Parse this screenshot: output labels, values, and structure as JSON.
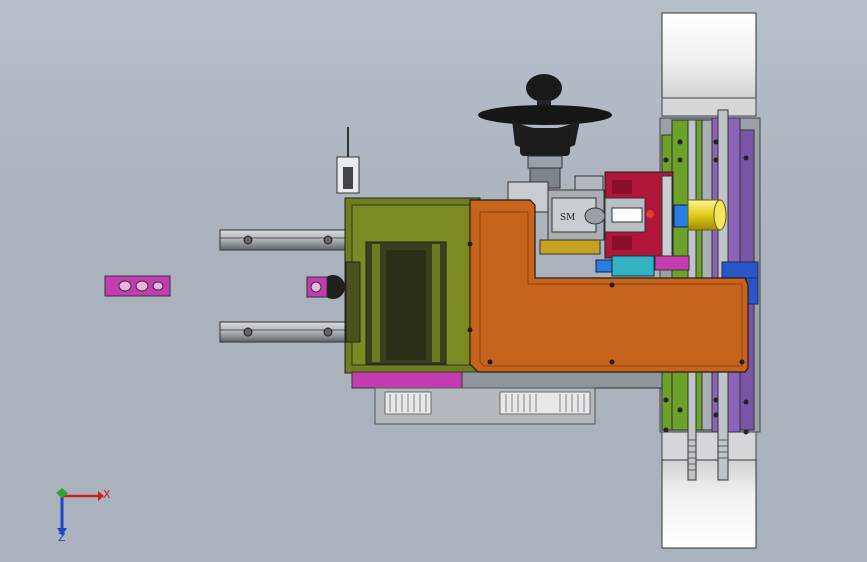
{
  "window": {
    "title": ""
  },
  "colors": {
    "background": "#aeb6c0",
    "olive_housing": "#6f7d1d",
    "orange_plate": "#c6641e",
    "magenta": "#c33cb0",
    "crimson_block": "#b0153a",
    "violet_plate": "#8b63b7",
    "green_rail": "#6da22a",
    "yellow_shaft": "#e2cc19",
    "axis_x": "#d21d1d",
    "axis_y": "#2aa62a",
    "axis_z": "#2243c9"
  },
  "parts": {
    "motor_label": "SM"
  },
  "axes": {
    "x_label": "X",
    "z_label": "Z"
  }
}
